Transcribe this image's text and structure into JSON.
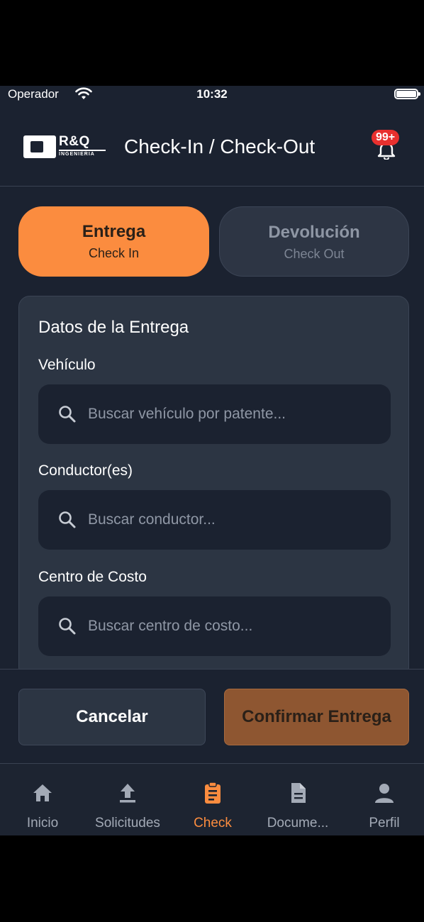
{
  "status_bar": {
    "carrier": "Operador",
    "time": "10:32"
  },
  "header": {
    "logo_text": "R&Q",
    "logo_subtext": "INGENIERIA",
    "title": "Check-In / Check-Out",
    "notification_badge": "99+"
  },
  "segments": [
    {
      "title": "Entrega",
      "subtitle": "Check In",
      "active": true
    },
    {
      "title": "Devolución",
      "subtitle": "Check Out",
      "active": false
    }
  ],
  "form": {
    "title": "Datos de la Entrega",
    "fields": [
      {
        "label": "Vehículo",
        "placeholder": "Buscar vehículo por patente...",
        "value": ""
      },
      {
        "label": "Conductor(es)",
        "placeholder": "Buscar conductor...",
        "value": ""
      },
      {
        "label": "Centro de Costo",
        "placeholder": "Buscar centro de costo...",
        "value": ""
      }
    ]
  },
  "actions": {
    "cancel_label": "Cancelar",
    "confirm_label": "Confirmar Entrega"
  },
  "tabs": [
    {
      "label": "Inicio",
      "icon": "home-icon"
    },
    {
      "label": "Solicitudes",
      "icon": "upload-icon"
    },
    {
      "label": "Check",
      "icon": "clipboard-icon",
      "active": true
    },
    {
      "label": "Docume...",
      "icon": "document-icon"
    },
    {
      "label": "Perfil",
      "icon": "person-icon"
    }
  ],
  "colors": {
    "accent": "#fb8c3f",
    "background": "#1b2230",
    "card": "#2c3543",
    "confirm_button": "#8e5631",
    "badge": "#e8302e"
  }
}
